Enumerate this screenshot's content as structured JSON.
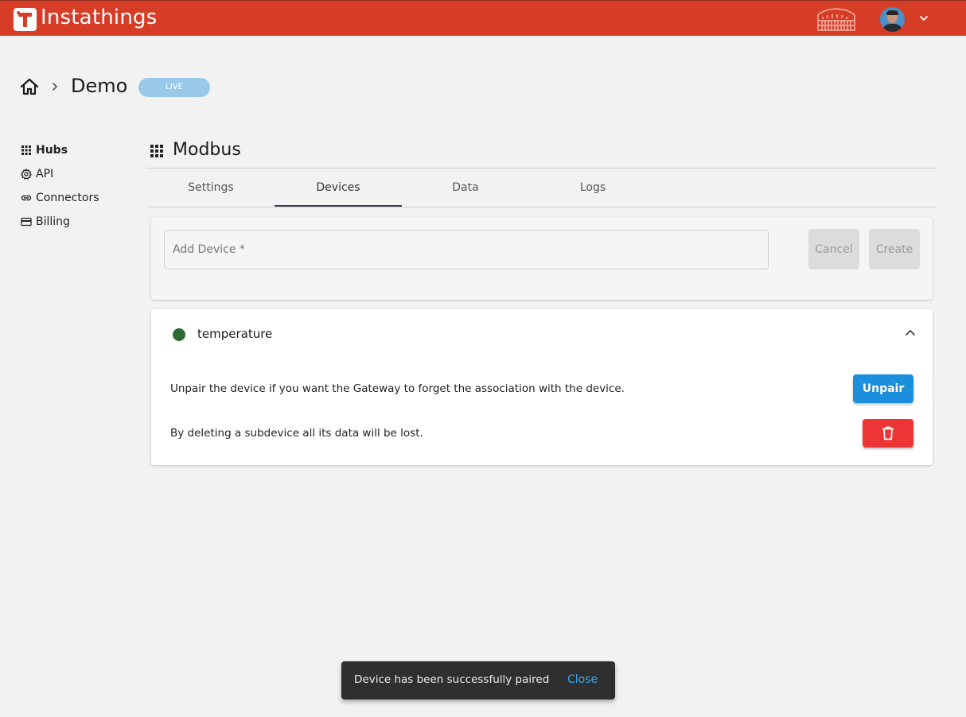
{
  "app": {
    "name": "Instathings",
    "brand_color": "#d73c27"
  },
  "header": {
    "decoration_icon": "colosseum-icon",
    "avatar_icon": "user-avatar",
    "menu_icon": "chevron-down-icon"
  },
  "breadcrumb": {
    "home_icon": "home-icon",
    "separator_icon": "chevron-right-icon",
    "title": "Demo",
    "badge": "LIVE"
  },
  "sidebar": {
    "items": [
      {
        "label": "Hubs",
        "icon": "grid-icon",
        "active": true
      },
      {
        "label": "API",
        "icon": "gear-icon",
        "active": false
      },
      {
        "label": "Connectors",
        "icon": "link-icon",
        "active": false
      },
      {
        "label": "Billing",
        "icon": "credit-card-icon",
        "active": false
      }
    ]
  },
  "section": {
    "icon": "grid-icon",
    "title": "Modbus"
  },
  "tabs": [
    {
      "label": "Settings",
      "active": false
    },
    {
      "label": "Devices",
      "active": true
    },
    {
      "label": "Data",
      "active": false
    },
    {
      "label": "Logs",
      "active": false
    }
  ],
  "add_device": {
    "placeholder": "Add Device *",
    "cancel_label": "Cancel",
    "create_label": "Create"
  },
  "device": {
    "name": "temperature",
    "status_color": "#2e6b32",
    "unpair_text": "Unpair the device if you want the Gateway to forget the association with the device.",
    "unpair_label": "Unpair",
    "delete_text": "By deleting a subdevice all its data will be lost.",
    "delete_icon": "trash-icon",
    "unpair_color": "#1b8fdc",
    "delete_color": "#ee3535"
  },
  "snackbar": {
    "message": "Device has been successfully paired",
    "close_label": "Close"
  }
}
